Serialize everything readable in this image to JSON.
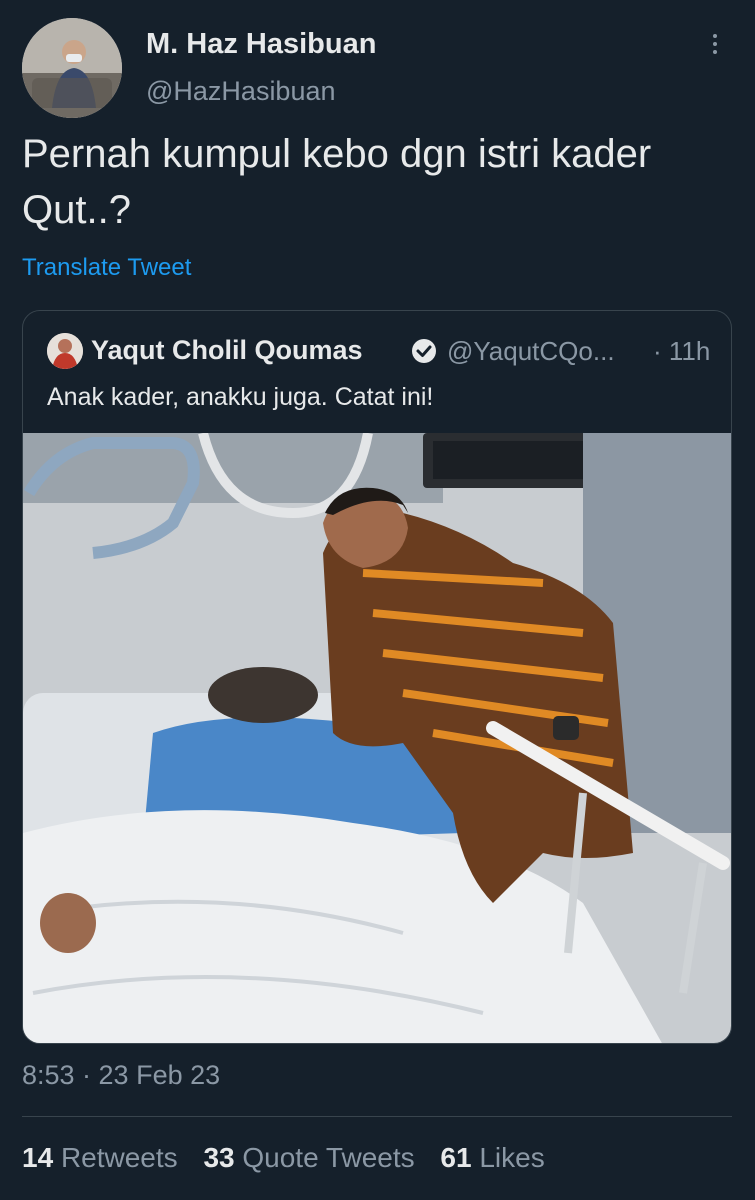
{
  "tweet": {
    "author_name": "M. Haz Hasibuan",
    "author_handle": "@HazHasibuan",
    "avatar_icon": "profile-photo",
    "text": "Pernah kumpul kebo dgn istri kader Qut..?",
    "translate_label": "Translate Tweet",
    "timestamp": "8:53 · 23 Feb 23"
  },
  "quoted": {
    "author_name": "Yaqut Cholil Qoumas",
    "verified": true,
    "author_handle": "@YaqutCQo...",
    "time": "· 11h",
    "text": "Anak kader, anakku juga. Catat ini!",
    "media_icon": "hospital-visit-photo"
  },
  "stats": {
    "retweets_count": "14",
    "retweets_label": "Retweets",
    "quotes_count": "33",
    "quotes_label": "Quote Tweets",
    "likes_count": "61",
    "likes_label": "Likes"
  },
  "colors": {
    "background": "#15202b",
    "text": "#e7e9ea",
    "secondary_text": "#8b98a5",
    "link": "#1d9bf0",
    "border": "#38444d"
  }
}
